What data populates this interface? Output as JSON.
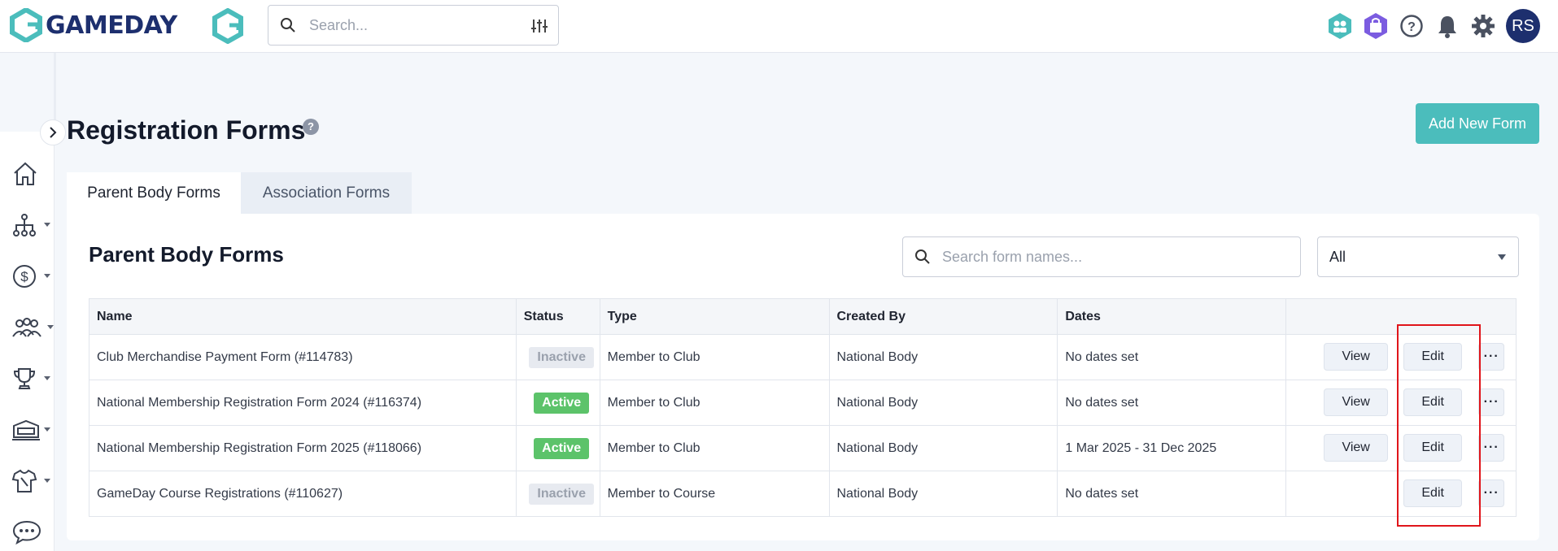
{
  "brand": {
    "name": "GAMEDAY",
    "accent": "#4bbdbc",
    "navy": "#1d2f6e"
  },
  "topbar": {
    "search_placeholder": "Search...",
    "icons": [
      "clubs-icon",
      "shop-icon",
      "help-icon",
      "bell-icon",
      "gear-icon"
    ],
    "avatar_initials": "RS"
  },
  "sidebar": {
    "items": [
      {
        "name": "home-icon",
        "has_caret": false
      },
      {
        "name": "org-chart-icon",
        "has_caret": true
      },
      {
        "name": "dollar-icon",
        "has_caret": true
      },
      {
        "name": "members-icon",
        "has_caret": true
      },
      {
        "name": "trophy-icon",
        "has_caret": true
      },
      {
        "name": "venue-icon",
        "has_caret": true
      },
      {
        "name": "jersey-icon",
        "has_caret": true
      },
      {
        "name": "chat-icon",
        "has_caret": false
      }
    ]
  },
  "page": {
    "title": "Registration Forms",
    "help": "?",
    "add_button": "Add New Form"
  },
  "tabs": [
    {
      "label": "Parent Body Forms",
      "active": true
    },
    {
      "label": "Association Forms",
      "active": false
    }
  ],
  "card": {
    "title": "Parent Body Forms",
    "search_placeholder": "Search form names...",
    "filter_value": "All"
  },
  "table": {
    "headers": [
      "Name",
      "Status",
      "Type",
      "Created By",
      "Dates",
      ""
    ],
    "rows": [
      {
        "name": "Club Merchandise Payment Form (#114783)",
        "status": "Inactive",
        "type": "Member to Club",
        "created_by": "National Body",
        "dates": "No dates set",
        "view": "View",
        "edit": "Edit",
        "more": "···"
      },
      {
        "name": "National Membership Registration Form 2024 (#116374)",
        "status": "Active",
        "type": "Member to Club",
        "created_by": "National Body",
        "dates": "No dates set",
        "view": "View",
        "edit": "Edit",
        "more": "···"
      },
      {
        "name": "National Membership Registration Form 2025 (#118066)",
        "status": "Active",
        "type": "Member to Club",
        "created_by": "National Body",
        "dates": "1 Mar 2025 - 31 Dec 2025",
        "view": "View",
        "edit": "Edit",
        "more": "···"
      },
      {
        "name": "GameDay Course Registrations (#110627)",
        "status": "Inactive",
        "type": "Member to Course",
        "created_by": "National Body",
        "dates": "No dates set",
        "view": null,
        "edit": "Edit",
        "more": "···"
      }
    ]
  }
}
